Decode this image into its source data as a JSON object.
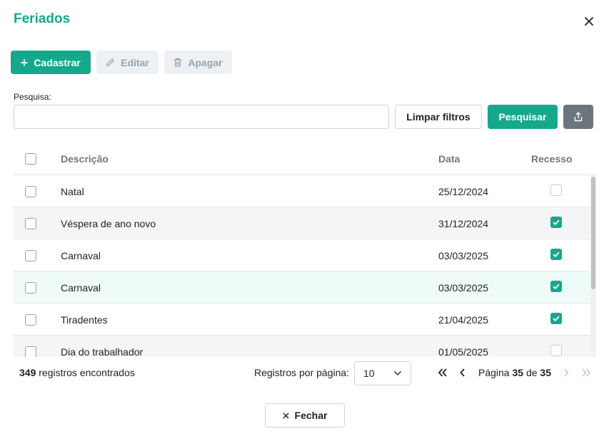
{
  "dialog": {
    "title": "Feriados"
  },
  "toolbar": {
    "add_label": "Cadastrar",
    "edit_label": "Editar",
    "delete_label": "Apagar"
  },
  "search": {
    "label": "Pesquisa:",
    "value": "",
    "placeholder": "",
    "clear_label": "Limpar filtros",
    "search_label": "Pesquisar"
  },
  "table": {
    "columns": {
      "description": "Descrição",
      "date": "Data",
      "recess": "Recesso"
    },
    "rows": [
      {
        "description": "Natal",
        "date": "25/12/2024",
        "recess": false
      },
      {
        "description": "Véspera de ano novo",
        "date": "31/12/2024",
        "recess": true
      },
      {
        "description": "Carnaval",
        "date": "03/03/2025",
        "recess": true
      },
      {
        "description": "Carnaval",
        "date": "03/03/2025",
        "recess": true
      },
      {
        "description": "Tiradentes",
        "date": "21/04/2025",
        "recess": true
      },
      {
        "description": "Dia do trabalhador",
        "date": "01/05/2025",
        "recess": false
      }
    ]
  },
  "footer": {
    "count": "349",
    "count_suffix": " registros encontrados",
    "per_page_label": "Registros por página:",
    "per_page_value": "10",
    "page_prefix": "Página ",
    "page_current": "35",
    "page_of": " de ",
    "page_total": "35",
    "close_label": "Fechar"
  },
  "colors": {
    "accent": "#15a88b",
    "hover_row": "#effbf8",
    "stripe_row": "#f4f5f7"
  }
}
